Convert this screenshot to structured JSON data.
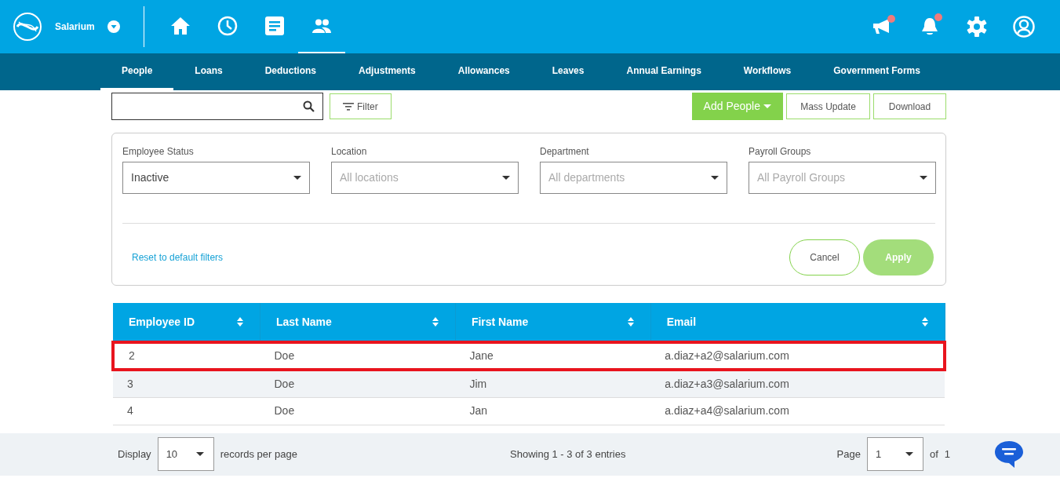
{
  "brand": {
    "name": "Salarium"
  },
  "top_nav": [
    {
      "kind": "home",
      "selected": false
    },
    {
      "kind": "clock",
      "selected": false
    },
    {
      "kind": "document",
      "selected": false
    },
    {
      "kind": "people",
      "selected": true
    }
  ],
  "top_actions": [
    {
      "kind": "megaphone",
      "badge": true
    },
    {
      "kind": "bell",
      "badge": true
    },
    {
      "kind": "settings",
      "badge": false
    },
    {
      "kind": "account",
      "badge": false
    }
  ],
  "tabs": [
    {
      "label": "People",
      "selected": true
    },
    {
      "label": "Loans",
      "selected": false
    },
    {
      "label": "Deductions",
      "selected": false
    },
    {
      "label": "Adjustments",
      "selected": false
    },
    {
      "label": "Allowances",
      "selected": false
    },
    {
      "label": "Leaves",
      "selected": false
    },
    {
      "label": "Annual Earnings",
      "selected": false
    },
    {
      "label": "Workflows",
      "selected": false
    },
    {
      "label": "Government Forms",
      "selected": false
    }
  ],
  "toolbar": {
    "filter_button": "Filter",
    "add_button": "Add People",
    "mass_update_button": "Mass Update",
    "download_button": "Download"
  },
  "filters": [
    {
      "label": "Employee Status",
      "value": "Inactive"
    },
    {
      "label": "Location",
      "placeholder": "All locations"
    },
    {
      "label": "Department",
      "placeholder": "All departments"
    },
    {
      "label": "Payroll Groups",
      "placeholder": "All Payroll Groups"
    }
  ],
  "filter_actions": {
    "reset_link": "Reset to default filters",
    "cancel_button": "Cancel",
    "apply_button": "Apply"
  },
  "table": {
    "columns": [
      "Employee ID",
      "Last Name",
      "First Name",
      "Email"
    ],
    "rows": [
      {
        "cells": [
          "2",
          "Doe",
          "Jane",
          "a.diaz+a2@salarium.com"
        ],
        "highlighted": true
      },
      {
        "cells": [
          "3",
          "Doe",
          "Jim",
          "a.diaz+a3@salarium.com"
        ],
        "highlighted": false
      },
      {
        "cells": [
          "4",
          "Doe",
          "Jan",
          "a.diaz+a4@salarium.com"
        ],
        "highlighted": false
      }
    ]
  },
  "footer": {
    "display_label": "Display",
    "page_size": "10",
    "records_label": "records per page",
    "summary": "Showing 1 - 3 of 3 entries",
    "page_label": "Page",
    "page": "1",
    "of_label": "of",
    "page_count": "1"
  }
}
